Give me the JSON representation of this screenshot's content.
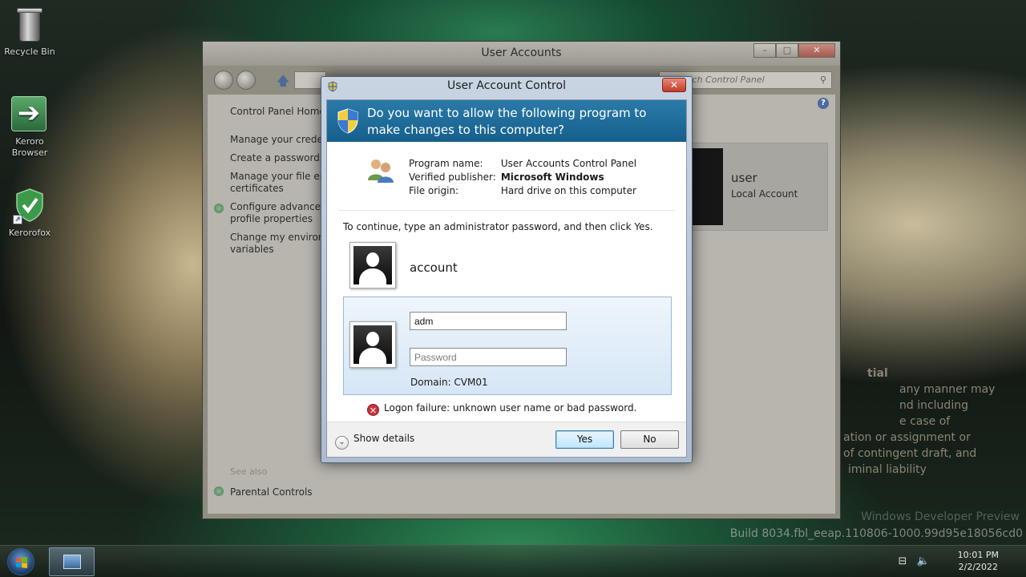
{
  "desktop": {
    "icons": [
      {
        "label": "Recycle Bin"
      },
      {
        "label": "Keroro Browser"
      },
      {
        "label": "Kerorofox"
      }
    ],
    "watermark": {
      "lines": [
        "tial",
        "any manner may",
        "nd including",
        "e case of",
        "ation or assignment or",
        "of contingent draft, and",
        "iminal liability"
      ],
      "build_line1": "Windows Developer Preview",
      "build_line2": "Build 8034.fbl_eeap.110806-1000.99d95e18056cd0"
    }
  },
  "background_window": {
    "title": "User Accounts",
    "search_placeholder": "rch Control Panel",
    "sidebar": {
      "home": "Control Panel Home",
      "items": [
        "Manage your credentials",
        "Create a password reset disk",
        "Manage your file encryption",
        "certificates",
        "Configure advanced",
        "profile properties",
        "Change my environment",
        "variables"
      ],
      "see_also": "See also",
      "parental": "Parental Controls"
    },
    "user_card": {
      "name": "user",
      "type": "Local Account"
    }
  },
  "uac": {
    "title": "User Account Control",
    "close_label": "x",
    "prompt": "Do you want to allow the following program to make changes to this computer?",
    "program": {
      "name_label": "Program name:",
      "name_value": "User Accounts Control Panel",
      "publisher_label": "Verified publisher:",
      "publisher_value": "Microsoft Windows",
      "origin_label": "File origin:",
      "origin_value": "Hard drive on this computer"
    },
    "instruction": "To continue, type an administrator password, and then click Yes.",
    "account_name": "account",
    "username_value": "adm",
    "password_placeholder": "Password",
    "domain": "Domain: CVM01",
    "error": "Logon failure: unknown user name or bad password.",
    "show_details": "Show details",
    "yes_label": "Yes",
    "no_label": "No"
  },
  "taskbar": {
    "time": "10:01 PM",
    "date": "2/2/2022"
  }
}
